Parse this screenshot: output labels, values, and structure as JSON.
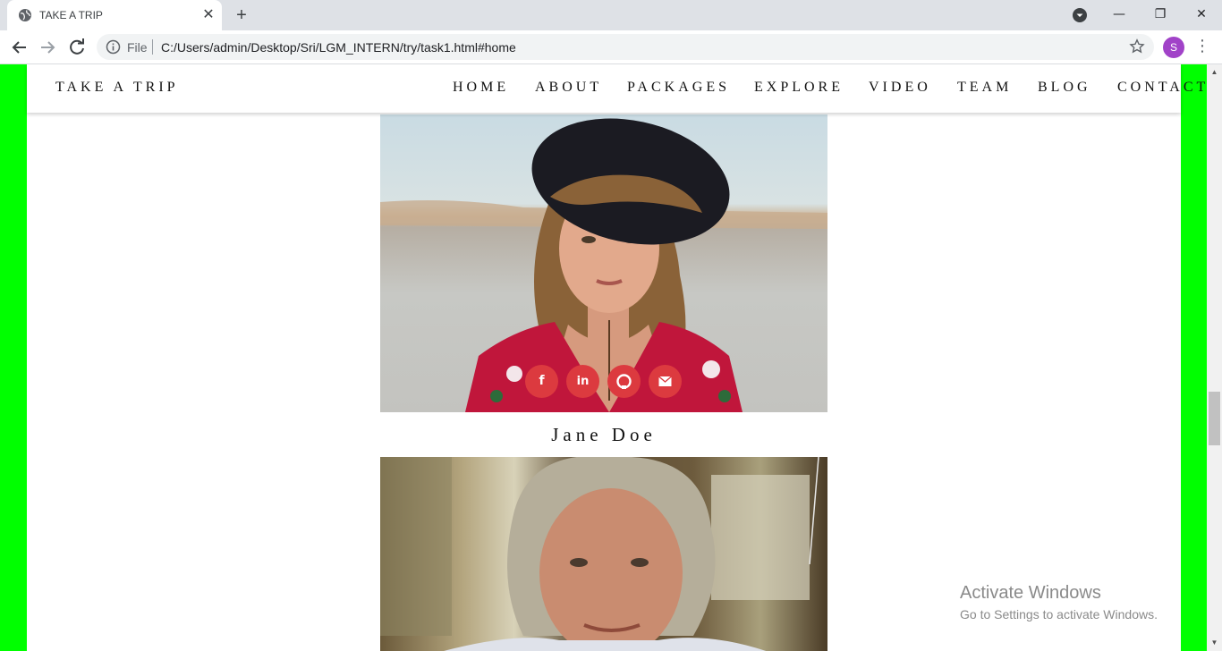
{
  "browser": {
    "tab_title": "TAKE A TRIP",
    "tab_close": "✕",
    "new_tab": "+",
    "window_controls": {
      "minimize": "—",
      "maximize": "❐",
      "close": "✕"
    },
    "file_label": "File",
    "url": "C:/Users/admin/Desktop/Sri/LGM_INTERN/try/task1.html#home",
    "profile_initial": "S",
    "menu": "⋮",
    "icons": [
      "globe-icon",
      "back-arrow-icon",
      "forward-arrow-icon",
      "reload-icon",
      "info-icon",
      "star-icon",
      "profile-dropdown-icon"
    ]
  },
  "site": {
    "brand": "TAKE A TRIP",
    "nav": [
      "HOME",
      "ABOUT",
      "PACKAGES",
      "EXPLORE",
      "VIDEO",
      "TEAM",
      "BLOG",
      "CONTACT"
    ],
    "colors": {
      "side_border": "#00ff00",
      "social_button": "#dc3a3f"
    }
  },
  "team": [
    {
      "name": "Jane Doe",
      "social": {
        "facebook": "f",
        "linkedin": "in",
        "github": "github-icon",
        "email": "envelope-icon"
      }
    },
    {
      "name": ""
    }
  ],
  "scrollbar": {
    "up": "▲",
    "down": "▼"
  },
  "watermark": {
    "title": "Activate Windows",
    "subtitle": "Go to Settings to activate Windows."
  }
}
